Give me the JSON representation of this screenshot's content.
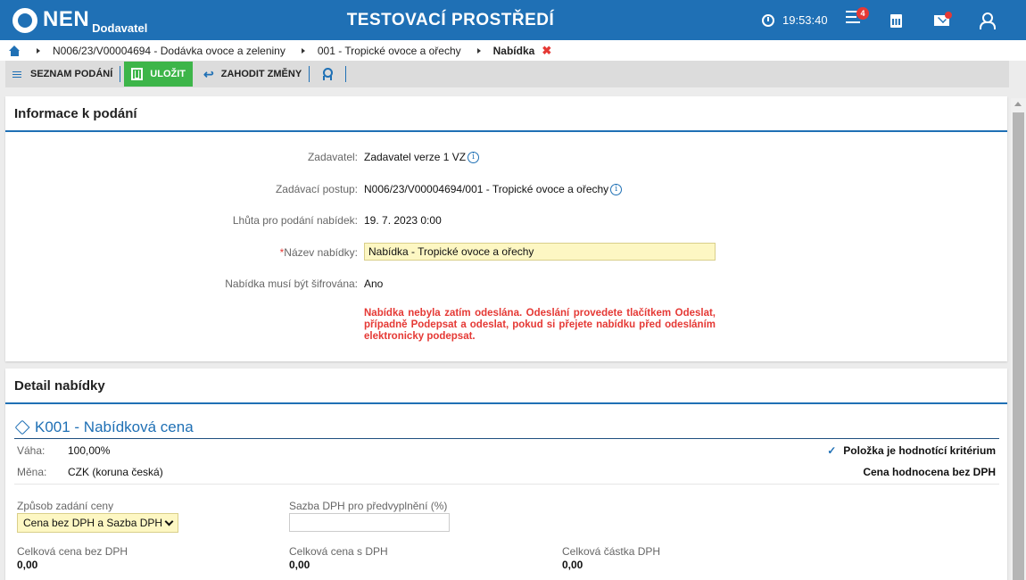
{
  "app": {
    "logo": "NEN",
    "logo_sub": "Dodavatel",
    "environment": "TESTOVACÍ PROSTŘEDÍ",
    "time": "19:53:40",
    "notifications_count": "4"
  },
  "breadcrumb": {
    "items": [
      "N006/23/V00004694 - Dodávka ovoce a zeleniny",
      "001 - Tropické ovoce a ořechy"
    ],
    "current": "Nabídka",
    "close": "✖"
  },
  "toolbar": {
    "list_label": "SEZNAM PODÁNÍ",
    "save_label": "ULOŽIT",
    "discard_label": "ZAHODIT ZMĚNY"
  },
  "info": {
    "title": "Informace k podání",
    "fields": {
      "zadavatel_label": "Zadavatel:",
      "zadavatel_value": "Zadavatel verze 1 VZ",
      "postup_label": "Zadávací postup:",
      "postup_value": "N006/23/V00004694/001 - Tropické ovoce a ořechy",
      "lhuta_label": "Lhůta pro podání nabídek:",
      "lhuta_value": "19. 7. 2023 0:00",
      "nazev_required": "*",
      "nazev_label": "Název nabídky:",
      "nazev_value": "Nabídka - Tropické ovoce a ořechy",
      "sifrovana_label": "Nabídka musí být šifrována:",
      "sifrovana_value": "Ano"
    },
    "warning": "Nabídka nebyla zatím odeslána. Odeslání provedete tlačítkem Odeslat, případně Podepsat a odeslat, pokud si přejete nabídku před odesláním elektronicky podepsat."
  },
  "detail": {
    "title": "Detail nabídky",
    "item_title": "K001 - Nabídková cena",
    "vaha_label": "Váha:",
    "vaha_value": "100,00%",
    "mena_label": "Měna:",
    "mena_value": "CZK (koruna česká)",
    "criterion": "Položka je hodnotící kritérium",
    "evaluation": "Cena hodnocena bez DPH",
    "zpusob_label": "Způsob zadání ceny",
    "zpusob_value": "Cena bez DPH a Sazba DPH",
    "sazba_label": "Sazba DPH pro předvyplnění (%)",
    "sazba_value": "",
    "bez_dph_label": "Celková cena bez DPH",
    "bez_dph_value": "0,00",
    "s_dph_label": "Celková cena s DPH",
    "s_dph_value": "0,00",
    "castka_dph_label": "Celková částka DPH",
    "castka_dph_value": "0,00"
  },
  "colors": {
    "brand_blue": "#1f70b5",
    "save_green": "#3db549",
    "warning_red": "#e53935",
    "input_yellow": "#fdf7c3"
  },
  "icons": [
    "clock-icon",
    "menu-icon",
    "calculator-icon",
    "mail-icon",
    "user-icon",
    "home-icon",
    "hamburger-icon",
    "document-icon",
    "undo-icon",
    "award-icon",
    "info-icon",
    "tag-icon",
    "check-icon",
    "chevron-down-icon"
  ]
}
